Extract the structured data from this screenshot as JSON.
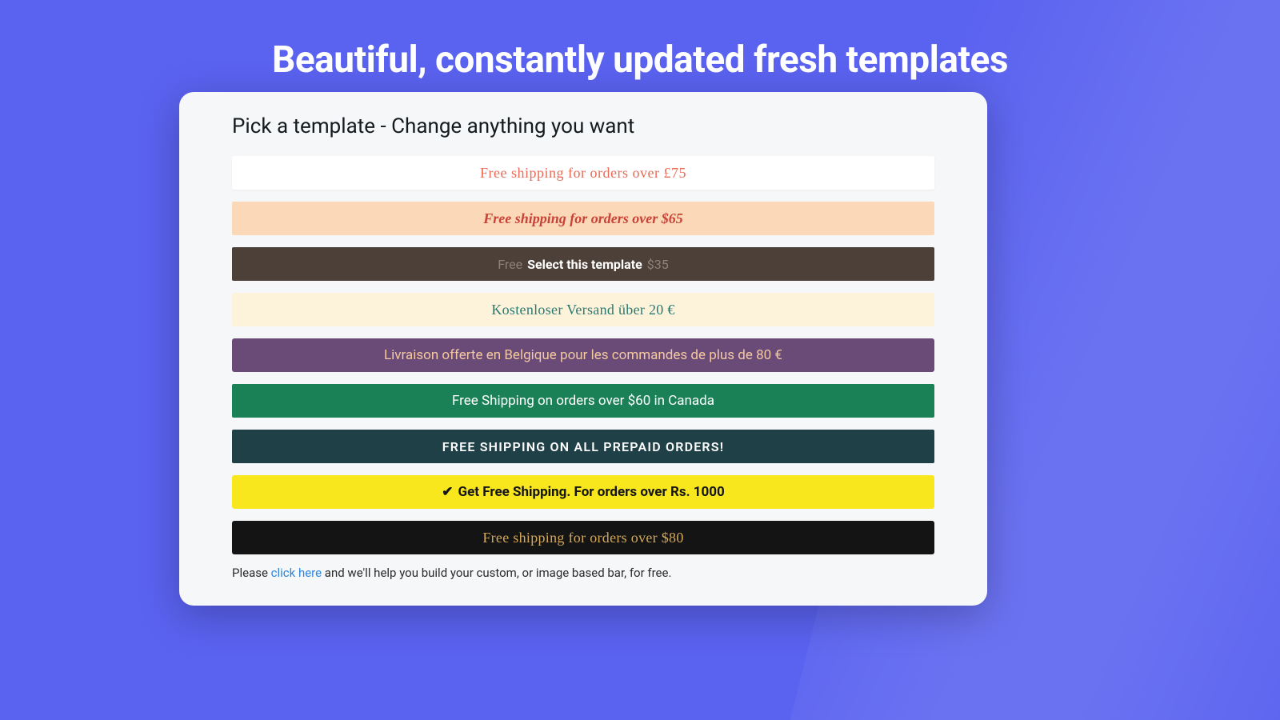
{
  "hero": {
    "title": "Beautiful, constantly updated fresh templates"
  },
  "card": {
    "title": "Pick a template - Change anything you want",
    "help_prefix": "Please ",
    "help_link": "click here",
    "help_suffix": " and we'll help you build your custom, or image based bar, for free."
  },
  "bars": {
    "b1": "Free shipping for orders over £75",
    "b2": "Free shipping for orders over $65",
    "b3_faint_left": "Free",
    "b3_select": "Select this template",
    "b3_faint_right": "$35",
    "b4": "Kostenloser Versand über 20 €",
    "b5": "Livraison offerte en Belgique pour les commandes de plus de 80 €",
    "b6": "Free Shipping on orders over $60 in Canada",
    "b7": "FREE SHIPPING ON ALL PREPAID ORDERS!",
    "b8_check": "✔",
    "b8": "Get Free Shipping. For orders over Rs. 1000",
    "b9": "Free shipping for orders over $80"
  }
}
